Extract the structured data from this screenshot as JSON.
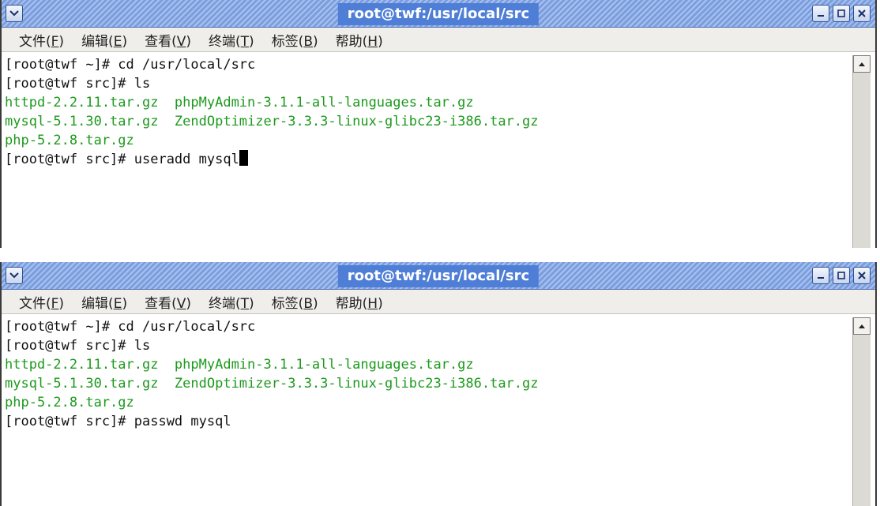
{
  "windows": [
    {
      "title": "root@twf:/usr/local/src",
      "menu": [
        {
          "label": "文件(",
          "key": "F",
          "end": ")"
        },
        {
          "label": "编辑(",
          "key": "E",
          "end": ")"
        },
        {
          "label": "查看(",
          "key": "V",
          "end": ")"
        },
        {
          "label": "终端(",
          "key": "T",
          "end": ")"
        },
        {
          "label": "标签(",
          "key": "B",
          "end": ")"
        },
        {
          "label": "帮助(",
          "key": "H",
          "end": ")"
        }
      ],
      "lines": [
        "[root@twf ~]# cd /usr/local/src",
        "[root@twf src]# ls",
        "httpd-2.2.11.tar.gz  phpMyAdmin-3.1.1-all-languages.tar.gz",
        "mysql-5.1.30.tar.gz  ZendOptimizer-3.3.3-linux-glibc23-i386.tar.gz",
        "php-5.2.8.tar.gz",
        "[root@twf src]# useradd mysql"
      ]
    },
    {
      "title": "root@twf:/usr/local/src",
      "menu": [
        {
          "label": "文件(",
          "key": "F",
          "end": ")"
        },
        {
          "label": "编辑(",
          "key": "E",
          "end": ")"
        },
        {
          "label": "查看(",
          "key": "V",
          "end": ")"
        },
        {
          "label": "终端(",
          "key": "T",
          "end": ")"
        },
        {
          "label": "标签(",
          "key": "B",
          "end": ")"
        },
        {
          "label": "帮助(",
          "key": "H",
          "end": ")"
        }
      ],
      "lines": [
        "[root@twf ~]# cd /usr/local/src",
        "[root@twf src]# ls",
        "httpd-2.2.11.tar.gz  phpMyAdmin-3.1.1-all-languages.tar.gz",
        "mysql-5.1.30.tar.gz  ZendOptimizer-3.3.3-linux-glibc23-i386.tar.gz",
        "php-5.2.8.tar.gz",
        "[root@twf src]# passwd mysql"
      ]
    }
  ],
  "colors": {
    "file_listing": "#1d9a1d",
    "titlebar": "#7b9ede"
  },
  "icons": [
    "window-menu-icon",
    "minimize-icon",
    "maximize-icon",
    "close-icon",
    "scroll-up-arrow-icon"
  ]
}
